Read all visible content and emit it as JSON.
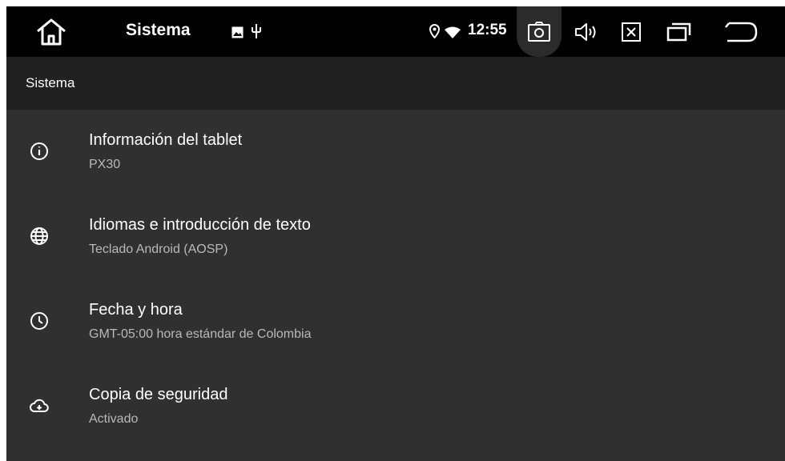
{
  "status_bar": {
    "app_title": "Sistema",
    "clock": "12:55",
    "icons": [
      "home-icon",
      "image-notification-icon",
      "usb-icon",
      "location-icon",
      "wifi-icon",
      "screenshot-camera-icon",
      "volume-icon",
      "close-app-icon",
      "recent-apps-icon",
      "back-icon"
    ]
  },
  "toolbar": {
    "title": "Sistema"
  },
  "settings": [
    {
      "title": "Información del tablet",
      "subtitle": "PX30",
      "icon": "info-icon"
    },
    {
      "title": "Idiomas e introducción de texto",
      "subtitle": "Teclado Android (AOSP)",
      "icon": "globe-icon"
    },
    {
      "title": "Fecha y hora",
      "subtitle": "GMT-05:00 hora estándar de Colombia",
      "icon": "clock-icon"
    },
    {
      "title": "Copia de seguridad",
      "subtitle": "Activado",
      "icon": "cloud-backup-icon"
    }
  ],
  "colors": {
    "statusbar": "#000000",
    "toolbar": "#212121",
    "background": "#303030",
    "primary_text": "#ffffff",
    "secondary_text": "#b9b9b9"
  }
}
